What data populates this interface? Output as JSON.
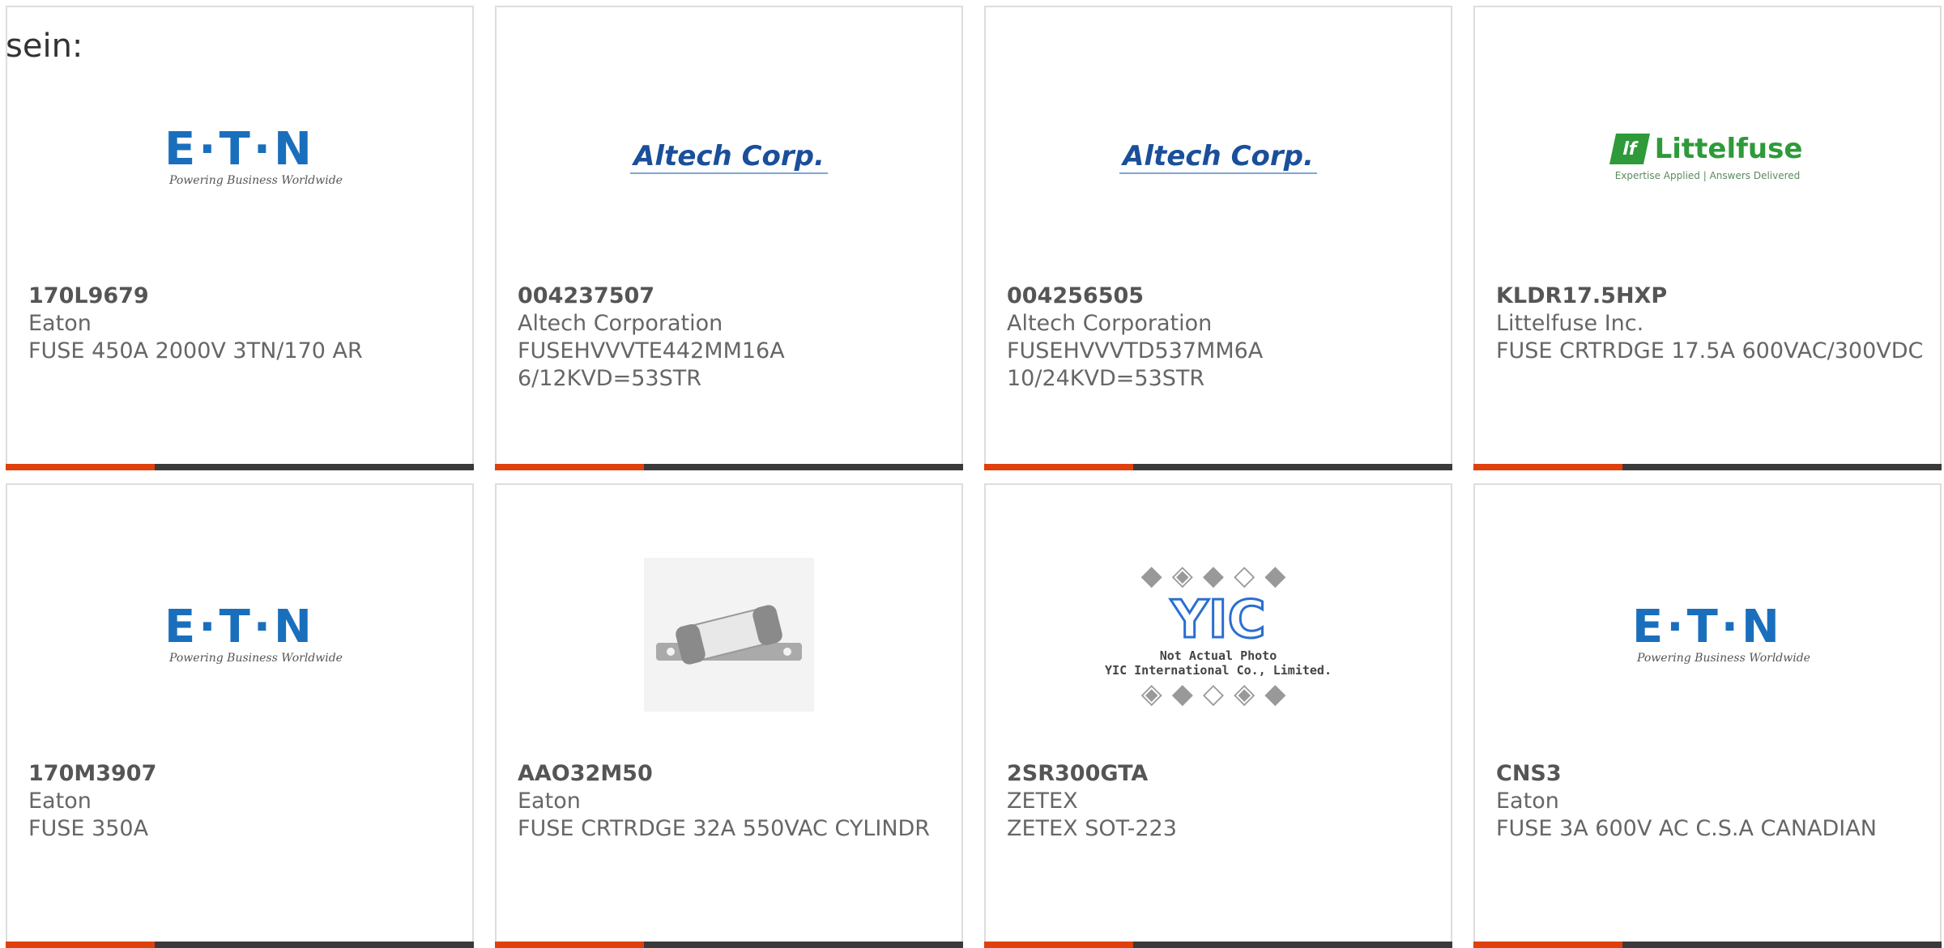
{
  "intro_text": "sein:",
  "products": [
    {
      "part_number": "170L9679",
      "manufacturer": "Eaton",
      "description": "FUSE 450A 2000V 3TN/170 AR",
      "logo": {
        "type": "eaton",
        "word": "E·T·N",
        "tagline": "Powering Business Worldwide"
      }
    },
    {
      "part_number": "004237507",
      "manufacturer": "Altech Corporation",
      "description": "FUSEHVVVTE442MM16A 6/12KVD=53STR",
      "logo": {
        "type": "altech",
        "word": "Altech Corp."
      }
    },
    {
      "part_number": "004256505",
      "manufacturer": "Altech Corporation",
      "description": "FUSEHVVVTD537MM6A 10/24KVD=53STR",
      "logo": {
        "type": "altech",
        "word": "Altech Corp."
      }
    },
    {
      "part_number": "KLDR17.5HXP",
      "manufacturer": "Littelfuse Inc.",
      "description": "FUSE CRTRDGE 17.5A 600VAC/300VDC",
      "logo": {
        "type": "littelfuse",
        "word": "Littelfuse",
        "tagline": "Expertise Applied | Answers Delivered"
      }
    },
    {
      "part_number": "170M3907",
      "manufacturer": "Eaton",
      "description": "FUSE 350A",
      "logo": {
        "type": "eaton",
        "word": "E·T·N",
        "tagline": "Powering Business Worldwide"
      }
    },
    {
      "part_number": "AAO32M50",
      "manufacturer": "Eaton",
      "description": "FUSE CRTRDGE 32A 550VAC CYLINDR",
      "logo": {
        "type": "fuse-photo"
      }
    },
    {
      "part_number": "2SR300GTA",
      "manufacturer": "ZETEX",
      "description": "ZETEX SOT-223",
      "logo": {
        "type": "yic",
        "word": "YIC",
        "line1": "Not Actual Photo",
        "line2": "YIC International Co., Limited."
      }
    },
    {
      "part_number": "CNS3",
      "manufacturer": "Eaton",
      "description": "FUSE 3A 600V AC C.S.A CANADIAN",
      "logo": {
        "type": "eaton",
        "word": "E·T·N",
        "tagline": "Powering Business Worldwide"
      }
    }
  ],
  "colors": {
    "accent": "#e0400e",
    "bar": "#3a3a3a",
    "eaton": "#1a6fbd",
    "altech": "#1a4f9a",
    "littelfuse": "#2e9a3a"
  }
}
